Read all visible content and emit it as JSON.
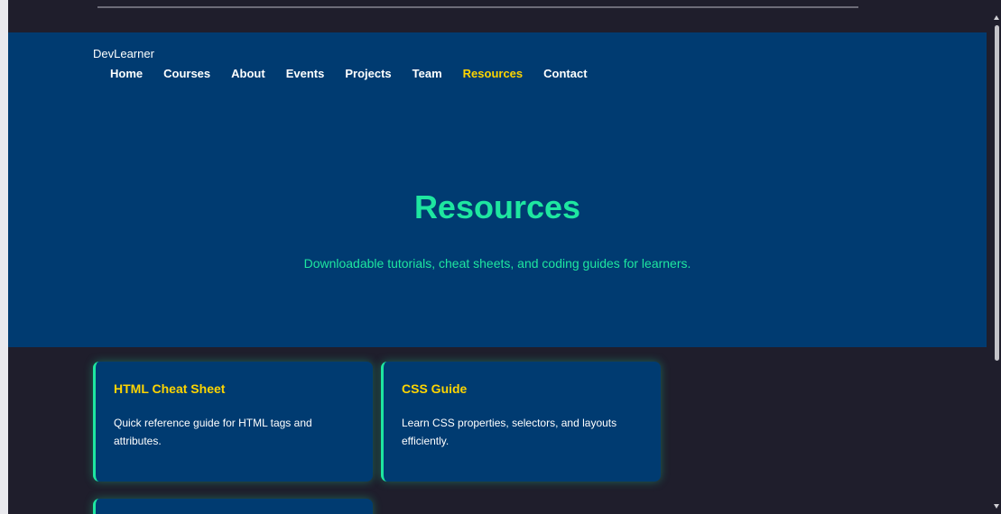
{
  "site": {
    "brand": "DevLearner"
  },
  "nav": {
    "items": [
      "Home",
      "Courses",
      "About",
      "Events",
      "Projects",
      "Team",
      "Resources",
      "Contact"
    ],
    "active": "Resources"
  },
  "hero": {
    "title": "Resources",
    "subtitle": "Downloadable tutorials, cheat sheets, and coding guides for learners."
  },
  "cards": [
    {
      "title": "HTML Cheat Sheet",
      "description": "Quick reference guide for HTML tags and attributes."
    },
    {
      "title": "CSS Guide",
      "description": "Learn CSS properties, selectors, and layouts efficiently."
    }
  ],
  "colors": {
    "background": "#1f1e2c",
    "hero": "#003b71",
    "accent_green": "#1ee6a0",
    "accent_yellow": "#ffd500",
    "text": "#ffffff"
  }
}
